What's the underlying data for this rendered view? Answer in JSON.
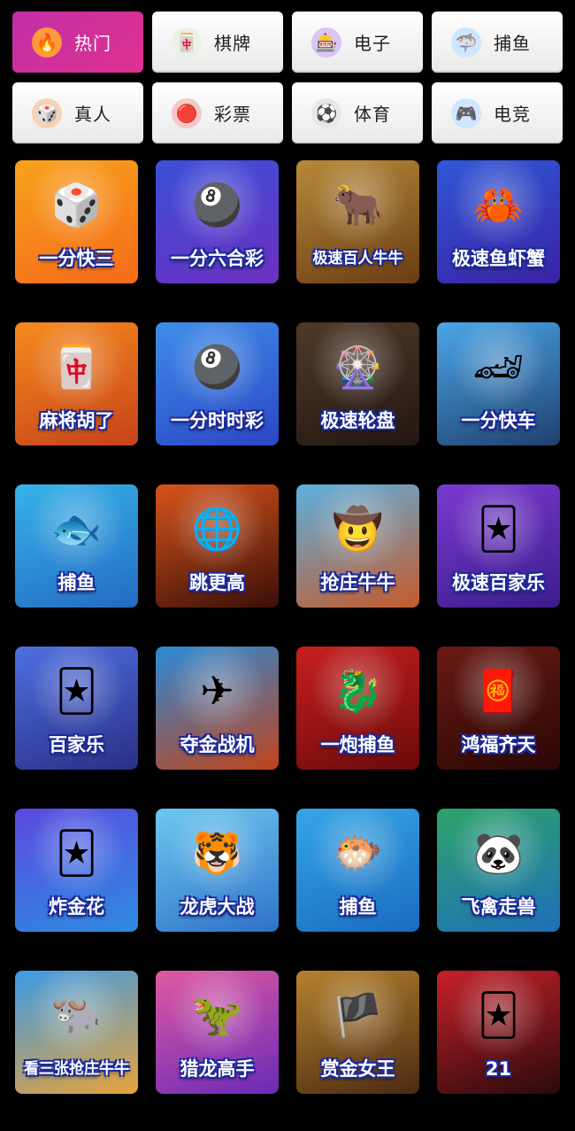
{
  "categories": [
    {
      "label": "热门",
      "icon": "fire-icon",
      "glyph": "🔥",
      "active": true,
      "icon_bg": "#ff9a3c"
    },
    {
      "label": "棋牌",
      "icon": "mahjong-tile-icon",
      "glyph": "🀄",
      "active": false,
      "icon_bg": "#e8f3e4"
    },
    {
      "label": "电子",
      "icon": "slot-machine-icon",
      "glyph": "🎰",
      "active": false,
      "icon_bg": "#d9c6f5"
    },
    {
      "label": "捕鱼",
      "icon": "shark-icon",
      "glyph": "🦈",
      "active": false,
      "icon_bg": "#cfe6ff"
    },
    {
      "label": "真人",
      "icon": "poker-chip-icon",
      "glyph": "🎲",
      "active": false,
      "icon_bg": "#f6d3b4"
    },
    {
      "label": "彩票",
      "icon": "lottery-ball-icon",
      "glyph": "🔴",
      "active": false,
      "icon_bg": "#f3c8c8"
    },
    {
      "label": "体育",
      "icon": "soccer-ball-icon",
      "glyph": "⚽",
      "active": false,
      "icon_bg": "#e8e8e8"
    },
    {
      "label": "电竞",
      "icon": "gamepad-icon",
      "glyph": "🎮",
      "active": false,
      "icon_bg": "#cfe6ff"
    }
  ],
  "games": [
    {
      "name": "一分快三",
      "glyph": "🎲",
      "c1": "#f7a21b",
      "c2": "#f56a1a"
    },
    {
      "name": "一分六合彩",
      "glyph": "🎱",
      "c1": "#3a4fd8",
      "c2": "#6d2fc0"
    },
    {
      "name": "极速百人牛牛",
      "glyph": "🐂",
      "c1": "#b8893a",
      "c2": "#6b3c13"
    },
    {
      "name": "极速鱼虾蟹",
      "glyph": "🦀",
      "c1": "#2f58d6",
      "c2": "#3a22a6"
    },
    {
      "name": "麻将胡了",
      "glyph": "🀄",
      "c1": "#f58b1e",
      "c2": "#c6421a"
    },
    {
      "name": "一分时时彩",
      "glyph": "🎱",
      "c1": "#3e8de8",
      "c2": "#2b47c6"
    },
    {
      "name": "极速轮盘",
      "glyph": "🎡",
      "c1": "#4e3a2a",
      "c2": "#231611"
    },
    {
      "name": "一分快车",
      "glyph": "🏎",
      "c1": "#4aa6e8",
      "c2": "#20406e"
    },
    {
      "name": "捕鱼",
      "glyph": "🐟",
      "c1": "#36b3e8",
      "c2": "#246bc4"
    },
    {
      "name": "跳更高",
      "glyph": "🌐",
      "c1": "#d8541a",
      "c2": "#3a0f08"
    },
    {
      "name": "抢庄牛牛",
      "glyph": "🤠",
      "c1": "#5bb0e0",
      "c2": "#c65a2a"
    },
    {
      "name": "极速百家乐",
      "glyph": "🃏",
      "c1": "#7a3ad0",
      "c2": "#3b1c8c"
    },
    {
      "name": "百家乐",
      "glyph": "🃏",
      "c1": "#4e6fe0",
      "c2": "#2a2f86"
    },
    {
      "name": "夺金战机",
      "glyph": "✈",
      "c1": "#2a8ad8",
      "c2": "#c1431a"
    },
    {
      "name": "一炮捕鱼",
      "glyph": "🐉",
      "c1": "#c81f1f",
      "c2": "#6a0a0a"
    },
    {
      "name": "鸿福齐天",
      "glyph": "🧧",
      "c1": "#6a1a14",
      "c2": "#2a0705"
    },
    {
      "name": "炸金花",
      "glyph": "🃏",
      "c1": "#5a4ae0",
      "c2": "#2e8ce0"
    },
    {
      "name": "龙虎大战",
      "glyph": "🐯",
      "c1": "#6ec8f0",
      "c2": "#2f72c8"
    },
    {
      "name": "捕鱼",
      "glyph": "🐡",
      "c1": "#36a6e6",
      "c2": "#1a6bc0"
    },
    {
      "name": "飞禽走兽",
      "glyph": "🐼",
      "c1": "#2ea36a",
      "c2": "#1e6fb8"
    },
    {
      "name": "看三张抢庄牛牛",
      "glyph": "🐃",
      "c1": "#3c9ae6",
      "c2": "#e8a33a"
    },
    {
      "name": "猎龙高手",
      "glyph": "🦖",
      "c1": "#e05aa0",
      "c2": "#6a2ab8"
    },
    {
      "name": "赏金女王",
      "glyph": "🏴",
      "c1": "#b7822e",
      "c2": "#4a2a12"
    },
    {
      "name": "21",
      "glyph": "🃏",
      "c1": "#c8202a",
      "c2": "#2a0a0c"
    }
  ]
}
